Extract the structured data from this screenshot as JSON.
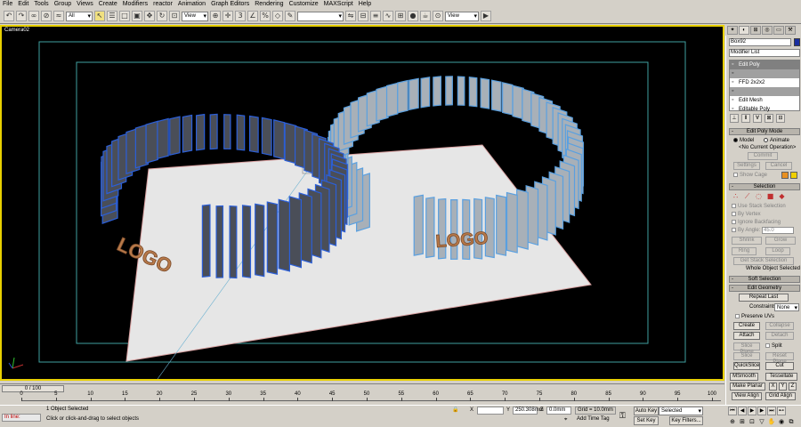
{
  "menu": [
    "File",
    "Edit",
    "Tools",
    "Group",
    "Views",
    "Create",
    "Modifiers",
    "reactor",
    "Animation",
    "Graph Editors",
    "Rendering",
    "Customize",
    "MAXScript",
    "Help"
  ],
  "toolbar": {
    "filter": "All",
    "ref_coord": "View",
    "named_sel": "",
    "view2": "View"
  },
  "viewport": {
    "label": "Camera02",
    "logo_left": "LOGO",
    "logo_right": "LOGO"
  },
  "panel": {
    "object_name": "Box92",
    "modifier_list": "Modifier List",
    "stack": [
      "Edit Poly",
      "FFD 2x2x2",
      "",
      "Edit Mesh",
      "Editable Poly"
    ],
    "edit_poly_mode": "Edit Poly Mode",
    "model": "Model",
    "animate": "Animate",
    "no_current_op": "<No Current Operation>",
    "commit": "Commit",
    "settings": "Settings",
    "cancel": "Cancel",
    "show_cage": "Show Cage",
    "selection": "Selection",
    "use_stack_sel": "Use Stack Selection",
    "by_vertex": "By Vertex",
    "ignore_backfacing": "Ignore Backfacing",
    "by_angle": "By Angle:",
    "angle_val": "45.0",
    "shrink": "Shrink",
    "grow": "Grow",
    "ring": "Ring",
    "loop": "Loop",
    "get_stack_sel": "Get Stack Selection",
    "whole_object": "Whole Object Selected",
    "soft_selection": "Soft Selection",
    "edit_geometry": "Edit Geometry",
    "repeat_last": "Repeat Last",
    "constraints": "Constraints:",
    "constraints_val": "None",
    "preserve_uvs": "Preserve UVs",
    "create": "Create",
    "collapse": "Collapse",
    "attach": "Attach",
    "detach": "Detach",
    "slice_plane": "Slice Plane",
    "split": "Split",
    "slice": "Slice",
    "reset_plane": "Reset Plane",
    "quickslice": "QuickSlice",
    "cut": "Cut",
    "msmooth": "MSmooth",
    "tessellate": "Tessellate",
    "make_planar": "Make Planar",
    "x": "X",
    "y": "Y",
    "z": "Z",
    "view_align": "View Align",
    "grid_align": "Grid Align"
  },
  "timeline": {
    "frame": "0 / 100",
    "ticks": [
      0,
      5,
      10,
      15,
      20,
      25,
      30,
      35,
      40,
      45,
      50,
      55,
      60,
      65,
      70,
      75,
      80,
      85,
      90,
      95,
      100
    ]
  },
  "status": {
    "maxscript": "In line:",
    "selected": "1 Object Selected",
    "prompt": "Click or click-and-drag to select objects",
    "x_label": "X",
    "x_val": "",
    "y_label": "Y",
    "y_val": "250.308mm",
    "z_label": "Z",
    "z_val": "0.0mm",
    "grid": "Grid = 10.0mm",
    "add_time_tag": "Add Time Tag",
    "auto_key": "Auto Key",
    "auto_key_sel": "Selected",
    "set_key": "Set Key",
    "key_filters": "Key Filters...",
    "frame_val": "0"
  },
  "colors": {
    "viewport_border": "#e8d000",
    "blue_tiles": "#2b5fd9",
    "grey_tiles": "#a8b4c0",
    "plane": "#e6e6e6",
    "logo": "#b87a4a"
  }
}
